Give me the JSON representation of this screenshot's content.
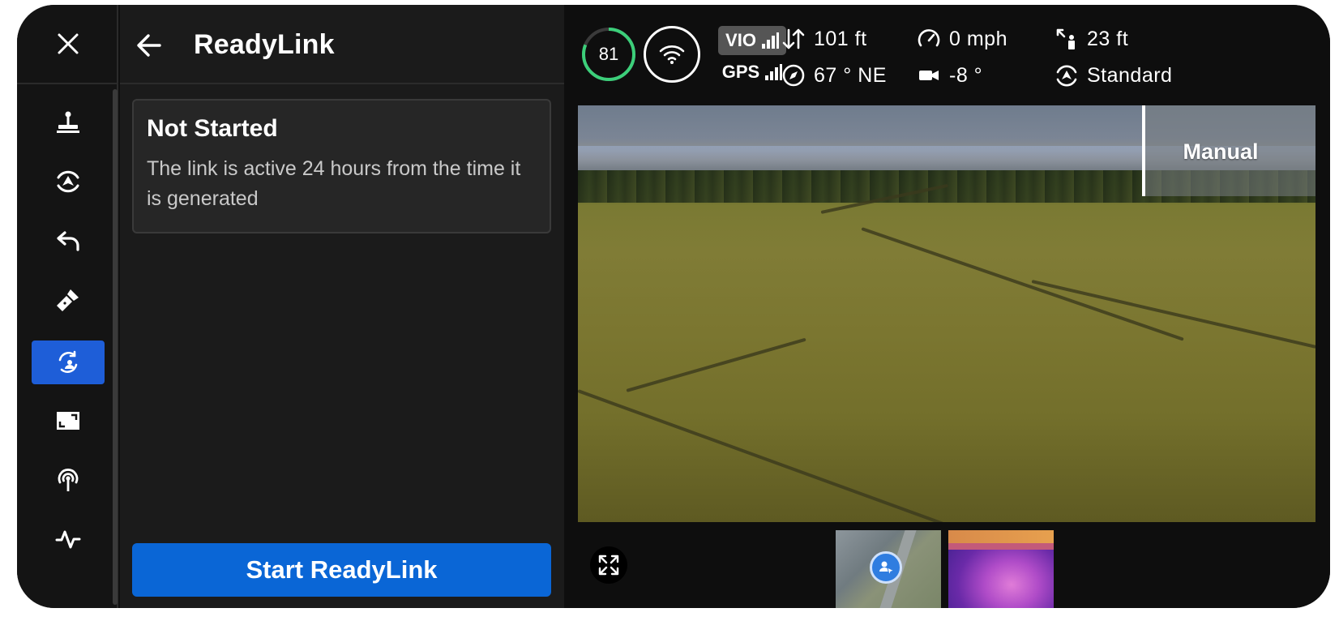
{
  "rail": {
    "items": [
      {
        "name": "joystick-icon",
        "label": "Controls"
      },
      {
        "name": "obstacle-avoidance-icon",
        "label": "Avoidance"
      },
      {
        "name": "return-icon",
        "label": "Return"
      },
      {
        "name": "flashlight-icon",
        "label": "Flashlight"
      },
      {
        "name": "readylink-icon",
        "label": "ReadyLink",
        "active": true
      },
      {
        "name": "aspect-ratio-icon",
        "label": "Display"
      },
      {
        "name": "broadcast-icon",
        "label": "Broadcast"
      },
      {
        "name": "activity-icon",
        "label": "Activity"
      }
    ]
  },
  "panel": {
    "title": "ReadyLink",
    "status_title": "Not Started",
    "status_description": "The link is active 24 hours from the time it is generated",
    "start_button": "Start ReadyLink"
  },
  "telemetry": {
    "battery": "81",
    "vio": "VIO",
    "gps": "GPS",
    "altitude": "101 ft",
    "heading": "67 ° NE",
    "speed": "0 mph",
    "gimbal": "-8 °",
    "distance": "23 ft",
    "mode": "Standard"
  },
  "feed": {
    "mode_label": "Manual"
  },
  "colors": {
    "accent": "#0a66d6",
    "rail_active": "#1e5ed8",
    "battery_ring": "#3ccf7a"
  }
}
